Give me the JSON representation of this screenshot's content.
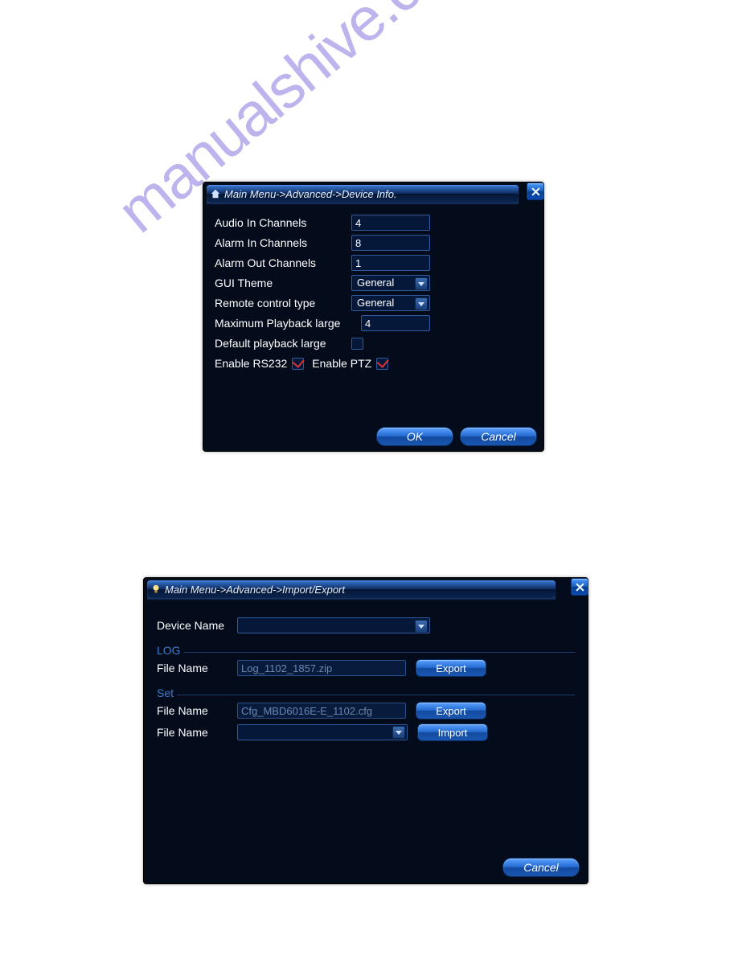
{
  "watermark": "manualshive.com",
  "dialog1": {
    "title": "Main Menu->Advanced->Device Info.",
    "fields": {
      "audio_in_label": "Audio In Channels",
      "audio_in_value": "4",
      "alarm_in_label": "Alarm In Channels",
      "alarm_in_value": "8",
      "alarm_out_label": "Alarm Out Channels",
      "alarm_out_value": "1",
      "gui_theme_label": "GUI Theme",
      "gui_theme_value": "General",
      "remote_type_label": "Remote control type",
      "remote_type_value": "General",
      "max_playback_label": "Maximum Playback large",
      "max_playback_value": "4",
      "default_playback_label": "Default playback large",
      "default_playback_checked": false,
      "enable_rs232_label": "Enable RS232",
      "enable_rs232_checked": true,
      "enable_ptz_label": "Enable PTZ",
      "enable_ptz_checked": true
    },
    "buttons": {
      "ok": "OK",
      "cancel": "Cancel"
    }
  },
  "dialog2": {
    "title": "Main Menu->Advanced->Import/Export",
    "device_name_label": "Device Name",
    "device_name_value": "",
    "groups": {
      "log": {
        "title": "LOG",
        "file_name_label": "File Name",
        "file_name_value": "Log_1102_1857.zip",
        "export_label": "Export"
      },
      "set": {
        "title": "Set",
        "file_name1_label": "File Name",
        "file_name1_value": "Cfg_MBD6016E-E_1102.cfg",
        "export_label": "Export",
        "file_name2_label": "File Name",
        "file_name2_value": "",
        "import_label": "Import"
      }
    },
    "buttons": {
      "cancel": "Cancel"
    }
  }
}
